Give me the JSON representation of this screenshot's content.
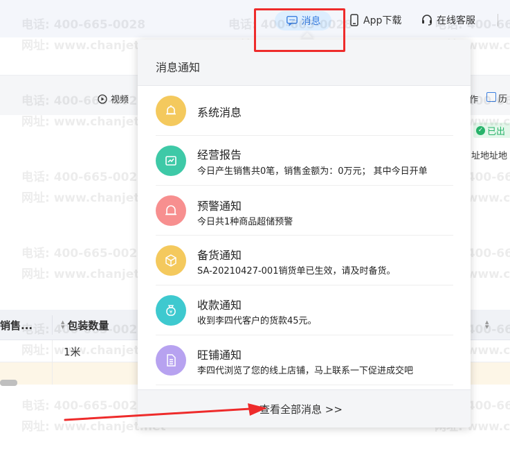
{
  "header": {
    "message_label": "消息",
    "app_download_label": "App下载",
    "online_service_label": "在线客服"
  },
  "toolbar": {
    "video_label": "视频",
    "right_fragment_1": "作",
    "right_fragment_2": "历"
  },
  "status": {
    "badge_label": "已出"
  },
  "address_fragment": "址地址地",
  "table": {
    "columns": [
      {
        "label": "销售..."
      },
      {
        "label": "包装数量"
      }
    ],
    "rows": [
      {
        "pack_qty": "1米"
      }
    ]
  },
  "watermark": {
    "phone": "电话: 400-665-0028",
    "site": "网址: www.chanjet.net"
  },
  "popup": {
    "title": "消息通知",
    "items": [
      {
        "title": "系统消息",
        "desc": "",
        "icon": "bell-icon",
        "color": "#f4c95d"
      },
      {
        "title": "经营报告",
        "desc": "今日产生销售共0笔，销售金额为：0万元；  其中今日开单",
        "icon": "report-chart-icon",
        "color": "#3ec9a7"
      },
      {
        "title": "预警通知",
        "desc": "今日共1种商品超储预警",
        "icon": "alarm-icon",
        "color": "#f78f8f"
      },
      {
        "title": "备货通知",
        "desc": "SA-20210427-001销货单已生效，请及时备货。",
        "icon": "box-icon",
        "color": "#f4c95d"
      },
      {
        "title": "收款通知",
        "desc": "收到李四代客户的货款45元。",
        "icon": "money-bag-icon",
        "color": "#3ec9cf"
      },
      {
        "title": "旺铺通知",
        "desc": "李四代浏览了您的线上店铺，马上联系一下促进成交吧",
        "icon": "document-icon",
        "color": "#b7a2f0"
      }
    ],
    "view_all_label": "查看全部消息 >>"
  },
  "colors": {
    "accent": "#3b7fe0",
    "highlight": "#ee2b2b",
    "success": "#27b36a"
  }
}
